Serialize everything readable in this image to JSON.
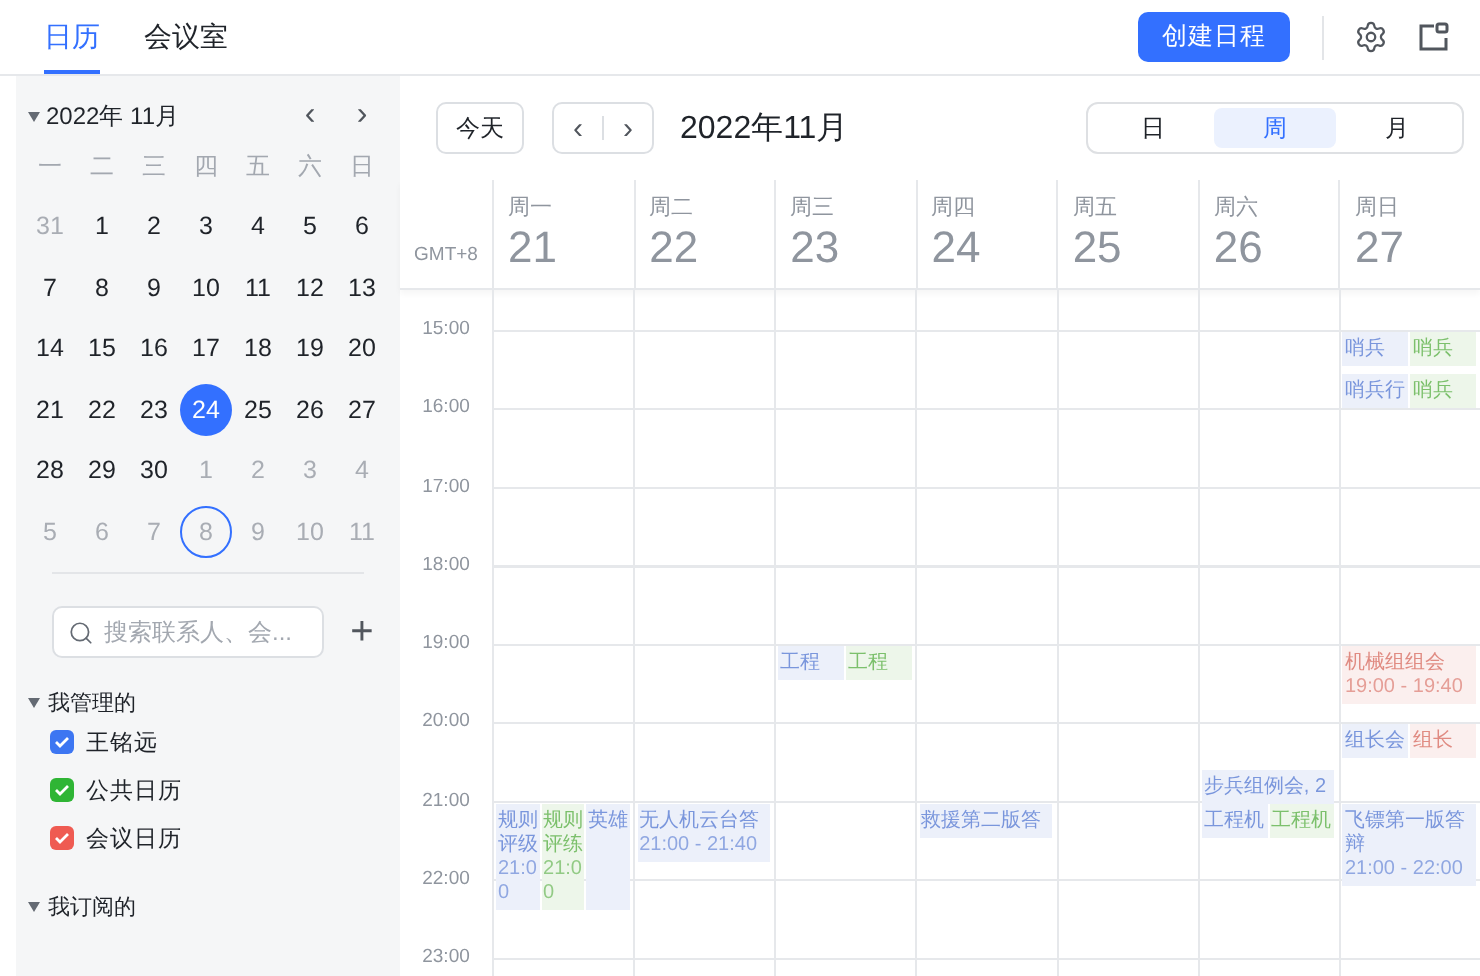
{
  "tabs": [
    {
      "label": "日历",
      "selected": true
    },
    {
      "label": "会议室",
      "selected": false
    }
  ],
  "create_button": "创建日程",
  "mini_calendar": {
    "title": "2022年 11月",
    "prev": "‹",
    "next": "›",
    "weekdays": [
      "一",
      "二",
      "三",
      "四",
      "五",
      "六",
      "日"
    ],
    "weeks": [
      [
        {
          "d": "31",
          "muted": true,
          "selected": false,
          "outlined": false
        },
        {
          "d": "1",
          "muted": false,
          "selected": false,
          "outlined": false
        },
        {
          "d": "2",
          "muted": false,
          "selected": false,
          "outlined": false
        },
        {
          "d": "3",
          "muted": false,
          "selected": false,
          "outlined": false
        },
        {
          "d": "4",
          "muted": false,
          "selected": false,
          "outlined": false
        },
        {
          "d": "5",
          "muted": false,
          "selected": false,
          "outlined": false
        },
        {
          "d": "6",
          "muted": false,
          "selected": false,
          "outlined": false
        }
      ],
      [
        {
          "d": "7",
          "muted": false,
          "selected": false,
          "outlined": false
        },
        {
          "d": "8",
          "muted": false,
          "selected": false,
          "outlined": false
        },
        {
          "d": "9",
          "muted": false,
          "selected": false,
          "outlined": false
        },
        {
          "d": "10",
          "muted": false,
          "selected": false,
          "outlined": false
        },
        {
          "d": "11",
          "muted": false,
          "selected": false,
          "outlined": false
        },
        {
          "d": "12",
          "muted": false,
          "selected": false,
          "outlined": false
        },
        {
          "d": "13",
          "muted": false,
          "selected": false,
          "outlined": false
        }
      ],
      [
        {
          "d": "14",
          "muted": false,
          "selected": false,
          "outlined": false
        },
        {
          "d": "15",
          "muted": false,
          "selected": false,
          "outlined": false
        },
        {
          "d": "16",
          "muted": false,
          "selected": false,
          "outlined": false
        },
        {
          "d": "17",
          "muted": false,
          "selected": false,
          "outlined": false
        },
        {
          "d": "18",
          "muted": false,
          "selected": false,
          "outlined": false
        },
        {
          "d": "19",
          "muted": false,
          "selected": false,
          "outlined": false
        },
        {
          "d": "20",
          "muted": false,
          "selected": false,
          "outlined": false
        }
      ],
      [
        {
          "d": "21",
          "muted": false,
          "selected": false,
          "outlined": false
        },
        {
          "d": "22",
          "muted": false,
          "selected": false,
          "outlined": false
        },
        {
          "d": "23",
          "muted": false,
          "selected": false,
          "outlined": false
        },
        {
          "d": "24",
          "muted": false,
          "selected": true,
          "outlined": false
        },
        {
          "d": "25",
          "muted": false,
          "selected": false,
          "outlined": false
        },
        {
          "d": "26",
          "muted": false,
          "selected": false,
          "outlined": false
        },
        {
          "d": "27",
          "muted": false,
          "selected": false,
          "outlined": false
        }
      ],
      [
        {
          "d": "28",
          "muted": false,
          "selected": false,
          "outlined": false
        },
        {
          "d": "29",
          "muted": false,
          "selected": false,
          "outlined": false
        },
        {
          "d": "30",
          "muted": false,
          "selected": false,
          "outlined": false
        },
        {
          "d": "1",
          "muted": true,
          "selected": false,
          "outlined": false
        },
        {
          "d": "2",
          "muted": true,
          "selected": false,
          "outlined": false
        },
        {
          "d": "3",
          "muted": true,
          "selected": false,
          "outlined": false
        },
        {
          "d": "4",
          "muted": true,
          "selected": false,
          "outlined": false
        }
      ],
      [
        {
          "d": "5",
          "muted": true,
          "selected": false,
          "outlined": false
        },
        {
          "d": "6",
          "muted": true,
          "selected": false,
          "outlined": false
        },
        {
          "d": "7",
          "muted": true,
          "selected": false,
          "outlined": false
        },
        {
          "d": "8",
          "muted": true,
          "selected": false,
          "outlined": true
        },
        {
          "d": "9",
          "muted": true,
          "selected": false,
          "outlined": false
        },
        {
          "d": "10",
          "muted": true,
          "selected": false,
          "outlined": false
        },
        {
          "d": "11",
          "muted": true,
          "selected": false,
          "outlined": false
        }
      ]
    ]
  },
  "search": {
    "placeholder": "搜索联系人、会..."
  },
  "add": "+",
  "sections": [
    {
      "label": "我管理的",
      "expanded": true,
      "calendars": [
        {
          "name": "王铭远",
          "checked": true,
          "color": "#3d76f2"
        },
        {
          "name": "公共日历",
          "checked": true,
          "color": "#2fb535"
        },
        {
          "name": "会议日历",
          "checked": true,
          "color": "#ef5b52"
        }
      ]
    },
    {
      "label": "我订阅的",
      "expanded": true
    }
  ],
  "toolbar": {
    "today": "今天",
    "prev": "‹",
    "next": "›",
    "title": "2022年11月"
  },
  "views": [
    {
      "label": "日",
      "selected": false
    },
    {
      "label": "周",
      "selected": true
    },
    {
      "label": "月",
      "selected": false
    }
  ],
  "timezone": "GMT+8",
  "days": [
    {
      "weekday": "周一",
      "date": "21"
    },
    {
      "weekday": "周二",
      "date": "22"
    },
    {
      "weekday": "周三",
      "date": "23"
    },
    {
      "weekday": "周四",
      "date": "24"
    },
    {
      "weekday": "周五",
      "date": "25"
    },
    {
      "weekday": "周六",
      "date": "26"
    },
    {
      "weekday": "周日",
      "date": "27"
    }
  ],
  "hours": [
    {
      "time": "15:00",
      "cells": [
        {},
        {},
        {},
        {},
        {},
        {},
        {
          "lines": [
            {
              "kind": "top",
              "events": [
                {
                  "title": "哨兵",
                  "color": "#7a96dc"
                },
                {
                  "title": "哨兵",
                  "color": "#7cc06c"
                }
              ]
            },
            {
              "kind": "top",
              "events": [
                {
                  "title": "哨兵行",
                  "color": "#7a96dc"
                },
                {
                  "title": "哨兵",
                  "color": "#7cc06c"
                }
              ]
            }
          ]
        }
      ]
    },
    {
      "time": "16:00",
      "cells": [
        {},
        {},
        {},
        {},
        {},
        {},
        {}
      ]
    },
    {
      "time": "17:00",
      "cells": [
        {},
        {},
        {},
        {},
        {},
        {},
        {}
      ]
    },
    {
      "time": "18:00",
      "cells": [
        {},
        {},
        {},
        {},
        {},
        {},
        {}
      ]
    },
    {
      "time": "19:00",
      "cells": [
        {},
        {},
        {
          "lines": [
            {
              "kind": "top",
              "events": [
                {
                  "title": "工程",
                  "color": "#7a96dc"
                },
                {
                  "title": "工程",
                  "color": "#7cc06c"
                }
              ]
            }
          ]
        },
        {},
        {},
        {},
        {
          "lines": [
            {
              "kind": "top",
              "events": [
                {
                  "title": "机械组组会",
                  "time": "19:00 - 19:40",
                  "color": "#e08b82"
                }
              ]
            }
          ]
        }
      ]
    },
    {
      "time": "20:00",
      "cells": [
        {},
        {},
        {},
        {},
        {},
        {
          "lines": [
            {
              "kind": "bottom",
              "events": [
                {
                  "title": "步兵组例会, 2",
                  "color": "#7a96dc"
                }
              ]
            }
          ]
        },
        {
          "lines": [
            {
              "kind": "top",
              "events": [
                {
                  "title": "组长会",
                  "color": "#7a96dc"
                },
                {
                  "title": "组长",
                  "color": "#e08b82"
                }
              ]
            }
          ]
        }
      ]
    },
    {
      "time": "21:00",
      "cells": [
        {
          "lines": [
            {
              "kind": "top",
              "events": [
                {
                  "title": "规则评级",
                  "time": "21:00",
                  "color": "#7a96dc"
                },
                {
                  "title": "规则评练",
                  "time": "21:00",
                  "color": "#7cc06c"
                },
                {
                  "title": "英雄",
                  "color": "#7a96dc"
                }
              ]
            }
          ]
        },
        {
          "lines": [
            {
              "kind": "top",
              "events": [
                {
                  "title": "无人机云台答",
                  "time": "21:00 - 21:40",
                  "color": "#7a96dc"
                }
              ]
            }
          ]
        },
        {},
        {
          "lines": [
            {
              "kind": "top",
              "events": [
                {
                  "title": "救援第二版答",
                  "color": "#7a96dc"
                }
              ]
            }
          ]
        },
        {},
        {
          "lines": [
            {
              "kind": "top",
              "events": [
                {
                  "title": "工程机",
                  "color": "#7a96dc"
                },
                {
                  "title": "工程机",
                  "color": "#7cc06c"
                }
              ]
            }
          ]
        },
        {
          "lines": [
            {
              "kind": "top",
              "events": [
                {
                  "title": "飞镖第一版答辩",
                  "time": "21:00 - 22:00",
                  "color": "#7a96dc"
                }
              ]
            }
          ]
        }
      ]
    },
    {
      "time": "22:00",
      "cells": [
        {},
        {},
        {},
        {},
        {},
        {},
        {}
      ]
    },
    {
      "time": "23:00",
      "cells": [
        {},
        {},
        {},
        {},
        {},
        {},
        {}
      ]
    }
  ]
}
